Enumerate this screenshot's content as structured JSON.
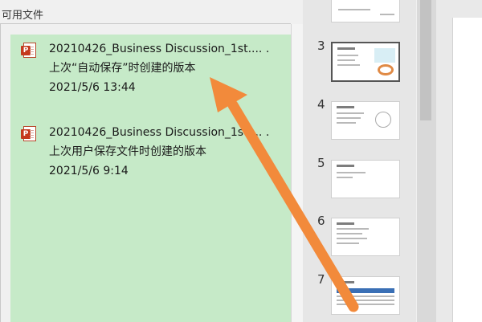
{
  "panel": {
    "heading": "可用文件"
  },
  "files": [
    {
      "icon": "powerpoint-file-icon",
      "badge": "P",
      "title": "20210426_Business Discussion_1st.... .",
      "subtitle": "上次“自动保存”时创建的版本",
      "timestamp": "2021/5/6 13:44"
    },
    {
      "icon": "powerpoint-file-icon",
      "badge": "P",
      "title": "20210426_Business Discussion_1st.... .",
      "subtitle": "上次用户保存文件时创建的版本",
      "timestamp": "2021/5/6 9:14"
    }
  ],
  "slides": [
    {
      "number": "3",
      "selected": true
    },
    {
      "number": "4",
      "selected": false
    },
    {
      "number": "5",
      "selected": false
    },
    {
      "number": "6",
      "selected": false
    },
    {
      "number": "7",
      "selected": false
    }
  ],
  "colors": {
    "file_list_background": "#c6eac8",
    "annotation_arrow": "#f28a3b",
    "powerpoint_red": "#c4391d"
  }
}
